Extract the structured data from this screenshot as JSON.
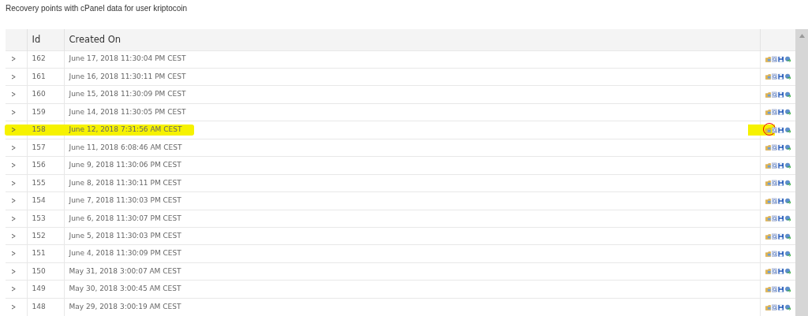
{
  "title": "Recovery points with cPanel data for user kriptocoin",
  "table": {
    "columns": [
      "Id",
      "Created On"
    ],
    "rows": [
      {
        "expander": ">",
        "id": "162",
        "created_on": "June 17, 2018 11:30:04 PM CEST",
        "highlighted": false
      },
      {
        "expander": ">",
        "id": "161",
        "created_on": "June 16, 2018 11:30:11 PM CEST",
        "highlighted": false
      },
      {
        "expander": ">",
        "id": "160",
        "created_on": "June 15, 2018 11:30:09 PM CEST",
        "highlighted": false
      },
      {
        "expander": ">",
        "id": "159",
        "created_on": "June 14, 2018 11:30:05 PM CEST",
        "highlighted": false
      },
      {
        "expander": ">",
        "id": "158",
        "created_on": "June 12, 2018 7:31:56 AM CEST",
        "highlighted": true
      },
      {
        "expander": ">",
        "id": "157",
        "created_on": "June 11, 2018 6:08:46 AM CEST",
        "highlighted": false
      },
      {
        "expander": ">",
        "id": "156",
        "created_on": "June 9, 2018 11:30:06 PM CEST",
        "highlighted": false
      },
      {
        "expander": ">",
        "id": "155",
        "created_on": "June 8, 2018 11:30:11 PM CEST",
        "highlighted": false
      },
      {
        "expander": ">",
        "id": "154",
        "created_on": "June 7, 2018 11:30:03 PM CEST",
        "highlighted": false
      },
      {
        "expander": ">",
        "id": "153",
        "created_on": "June 6, 2018 11:30:07 PM CEST",
        "highlighted": false
      },
      {
        "expander": ">",
        "id": "152",
        "created_on": "June 5, 2018 11:30:03 PM CEST",
        "highlighted": false
      },
      {
        "expander": ">",
        "id": "151",
        "created_on": "June 4, 2018 11:30:09 PM CEST",
        "highlighted": false
      },
      {
        "expander": ">",
        "id": "150",
        "created_on": "May 31, 2018 3:00:07 AM CEST",
        "highlighted": false
      },
      {
        "expander": ">",
        "id": "149",
        "created_on": "May 30, 2018 3:00:45 AM CEST",
        "highlighted": false
      },
      {
        "expander": ">",
        "id": "148",
        "created_on": "May 29, 2018 3:00:19 AM CEST",
        "highlighted": false
      }
    ]
  }
}
